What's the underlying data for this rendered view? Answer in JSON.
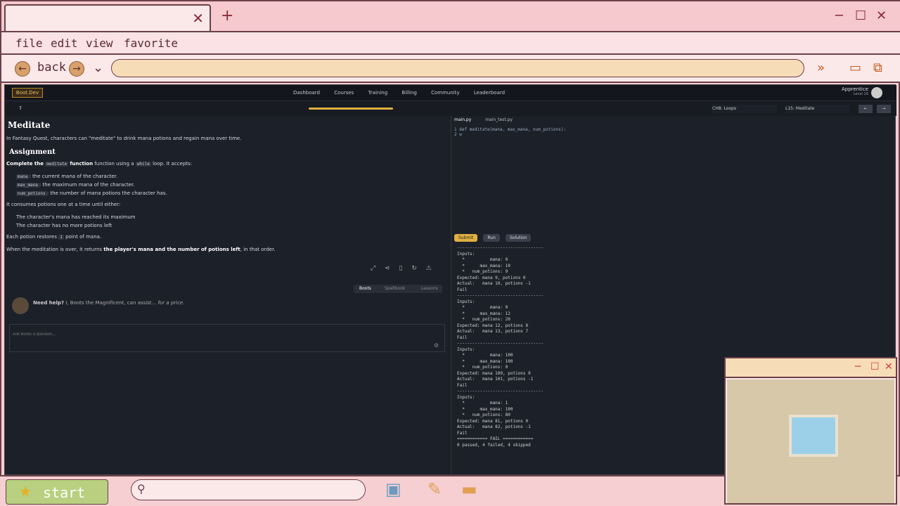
{
  "browser": {
    "back_label": "back"
  },
  "menu": [
    "file",
    "edit",
    "view",
    "favorite"
  ],
  "app": {
    "nav": [
      "Dashboard",
      "Courses",
      "Training",
      "Billing",
      "Community",
      "Leaderboard"
    ],
    "user_title": "Apprentice",
    "user_level": "Level 16",
    "chapter": "CH8: Loops",
    "lesson": "L15: Meditate",
    "streak": "7",
    "title": "Meditate",
    "intro": "In Fantasy Quest, characters can \"meditate\" to drink mana potions and regain mana over time.",
    "assignment_heading": "Assignment",
    "task_prefix": "Complete the",
    "task_fn": "meditate",
    "task_mid": "function using a",
    "task_kw": "while",
    "task_suffix": "loop. It accepts:",
    "args": [
      {
        "name": "mana",
        "desc": ": the current mana of the character."
      },
      {
        "name": "max_mana",
        "desc": ": the maximum mana of the character."
      },
      {
        "name": "num_potions",
        "desc": ": the number of mana potions the character has."
      }
    ],
    "consumes": "It consumes potions one at a time until either:",
    "conds": [
      "The character's mana has reached its maximum",
      "The character has no more potions left"
    ],
    "restore_prefix": "Each potion restores",
    "restore_val": "1",
    "restore_suffix": "point of mana.",
    "result_prefix": "When the meditation is over, it returns",
    "result_bold": "the player's mana and the number of potions left",
    "result_suffix": ", in that order.",
    "pills": [
      "Boots",
      "Spellbook",
      "Lessons"
    ],
    "help_bold": "Need help?",
    "help_text": "I, Boots the Magnificent, can assist...",
    "help_italic": "for a price.",
    "ask_placeholder": "Ask Boots a question...",
    "files": [
      "main.py",
      "main_test.py"
    ],
    "code": [
      "1  def meditate(mana, max_mana, num_potions):",
      "2      w"
    ],
    "buttons": [
      "Submit",
      "Run",
      "Solution"
    ],
    "output": "----------------------------------\nInputs:\n  *          mana: 0\n  *      max_mana: 10\n  *   num_potions: 9\nExpected: mana 9, potions 0\nActual:   mana 10, potions -1\nFail\n----------------------------------\nInputs:\n  *          mana: 0\n  *      max_mana: 12\n  *   num_potions: 20\nExpected: mana 12, potions 8\nActual:   mana 13, potions 7\nFail\n----------------------------------\nInputs:\n  *          mana: 100\n  *      max_mana: 100\n  *   num_potions: 0\nExpected: mana 100, potions 0\nActual:   mana 101, potions -1\nFail\n----------------------------------\nInputs:\n  *          mana: 1\n  *      max_mana: 100\n  *   num_potions: 80\nExpected: mana 81, potions 0\nActual:   mana 82, potions -1\nFail\n============ FAIL ============\n0 passed, 4 failed, 4 skipped"
  },
  "taskbar": {
    "start_label": "start"
  },
  "colors": {
    "accent": "#f0c040",
    "fail": "#d0d0d0",
    "shell": "#f6cfd3"
  }
}
